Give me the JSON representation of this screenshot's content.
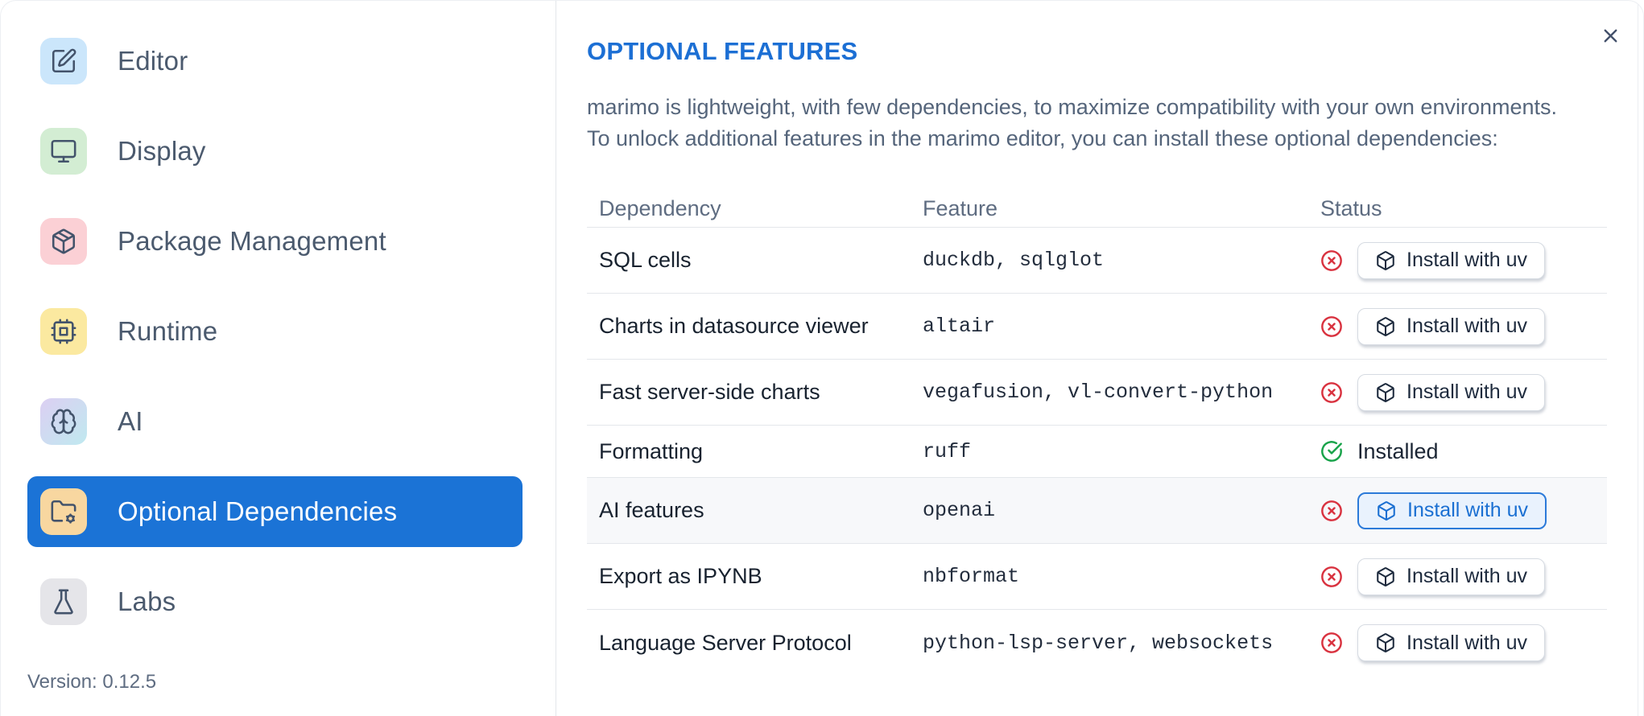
{
  "colors": {
    "accent": "#1b73d6",
    "title_blue": "#1c6fd4",
    "status_red": "#d93340",
    "status_green": "#18a34a"
  },
  "sidebar": {
    "items": [
      {
        "label": "Editor",
        "icon": "editor-pencil",
        "icon_bg": "#cbe6fb",
        "selected": false
      },
      {
        "label": "Display",
        "icon": "monitor",
        "icon_bg": "#d3edd3",
        "selected": false
      },
      {
        "label": "Package Management",
        "icon": "package",
        "icon_bg": "#fbd0d5",
        "selected": false
      },
      {
        "label": "Runtime",
        "icon": "cpu",
        "icon_bg": "#fbe9a0",
        "selected": false
      },
      {
        "label": "AI",
        "icon": "brain",
        "icon_bg": "linear-gradient(135deg,#dccff2,#c0e9f0)",
        "selected": false
      },
      {
        "label": "Optional Dependencies",
        "icon": "folder-cog",
        "icon_bg": "#f8d7a0",
        "selected": true
      },
      {
        "label": "Labs",
        "icon": "flask",
        "icon_bg": "#e5e5e9",
        "selected": false
      }
    ],
    "version_label": "Version: 0.12.5"
  },
  "panel": {
    "title": "OPTIONAL FEATURES",
    "description_line1": "marimo is lightweight, with few dependencies, to maximize compatibility with your own environments.",
    "description_line2": "To unlock additional features in the marimo editor, you can install these optional dependencies:"
  },
  "table": {
    "columns": [
      "Dependency",
      "Feature",
      "Status"
    ],
    "install_button_label": "Install with uv",
    "installed_label": "Installed",
    "rows": [
      {
        "dependency": "SQL cells",
        "feature": "duckdb, sqlglot",
        "status": "not_installed",
        "highlighted": false
      },
      {
        "dependency": "Charts in datasource viewer",
        "feature": "altair",
        "status": "not_installed",
        "highlighted": false
      },
      {
        "dependency": "Fast server-side charts",
        "feature": "vegafusion, vl-convert-python",
        "status": "not_installed",
        "highlighted": false
      },
      {
        "dependency": "Formatting",
        "feature": "ruff",
        "status": "installed",
        "highlighted": false
      },
      {
        "dependency": "AI features",
        "feature": "openai",
        "status": "not_installed",
        "highlighted": true
      },
      {
        "dependency": "Export as IPYNB",
        "feature": "nbformat",
        "status": "not_installed",
        "highlighted": false
      },
      {
        "dependency": "Language Server Protocol",
        "feature": "python-lsp-server, websockets",
        "status": "not_installed",
        "highlighted": false
      }
    ]
  }
}
